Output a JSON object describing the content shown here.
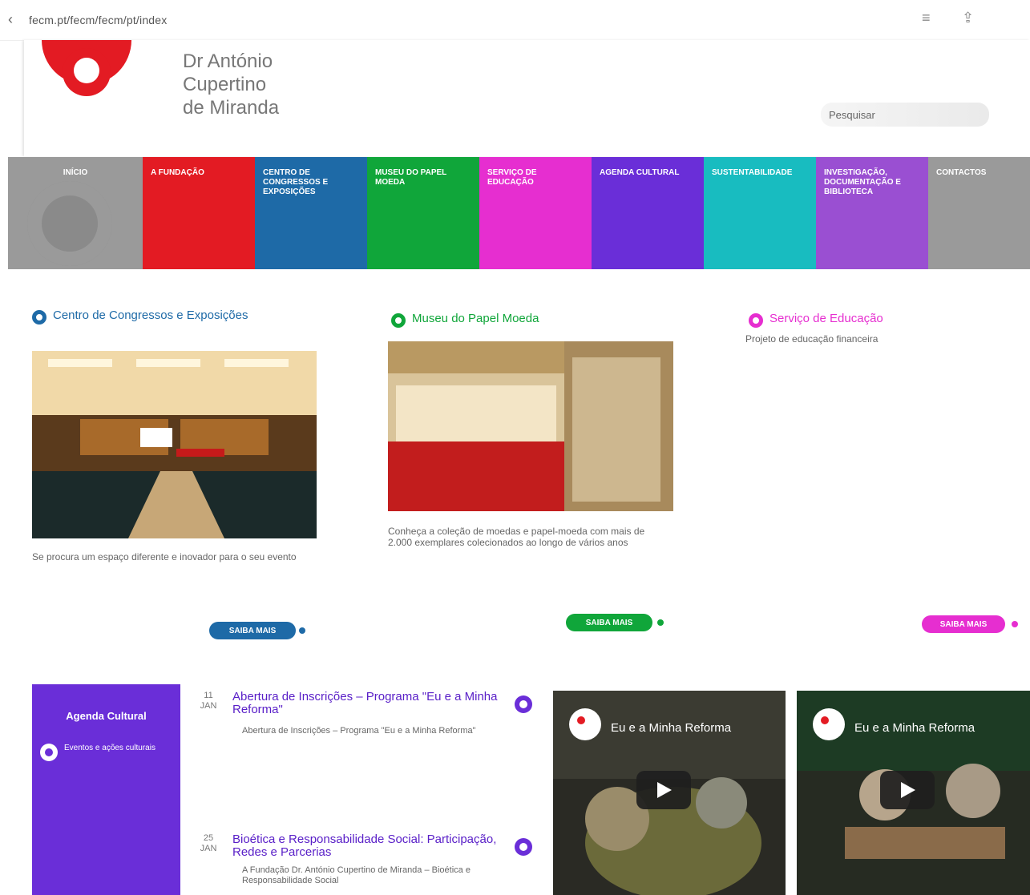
{
  "browser": {
    "url": "fecm.pt/fecm/fecm/pt/index",
    "icons": [
      "menu-icon",
      "share-icon"
    ]
  },
  "header": {
    "brand_lines": [
      "Dr António",
      "Cupertino",
      "de Miranda"
    ],
    "search_placeholder": "Pesquisar",
    "logo_color": "#e31b23"
  },
  "nav": {
    "items": [
      {
        "label": "INÍCIO",
        "color": "#9a9a9a"
      },
      {
        "label": "A FUNDAÇÃO",
        "color": "#e31b23"
      },
      {
        "label": "CENTRO DE CONGRESSOS E EXPOSIÇÕES",
        "color": "#1e6aa7"
      },
      {
        "label": "MUSEU DO PAPEL MOEDA",
        "color": "#10a63a"
      },
      {
        "label": "SERVIÇO DE EDUCAÇÃO",
        "color": "#e62ed0"
      },
      {
        "label": "AGENDA CULTURAL",
        "color": "#6a2ed8"
      },
      {
        "label": "SUSTENTABILIDADE",
        "color": "#18bcc0"
      },
      {
        "label": "INVESTIGAÇÃO, DOCUMENTAÇÃO E BIBLIOTECA",
        "color": "#9a4fd2"
      },
      {
        "label": "CONTACTOS",
        "color": "#9a9a9a"
      }
    ]
  },
  "columns": [
    {
      "title": "Centro de Congressos e Exposições",
      "desc": "Se procura um espaço diferente e inovador para o seu evento",
      "button": "SAIBA MAIS",
      "color": "#1e6aa7"
    },
    {
      "title": "Museu do Papel Moeda",
      "desc": "Conheça a coleção de moedas e papel-moeda com mais de 2.000 exemplares colecionados ao longo de vários anos",
      "button": "SAIBA MAIS",
      "color": "#10a63a"
    },
    {
      "title": "Serviço de Educação",
      "desc": "Projeto de educação financeira",
      "button": "SAIBA MAIS",
      "color": "#e62ed0"
    }
  ],
  "agenda": {
    "title": "Agenda Cultural",
    "link": "Eventos e ações culturais",
    "color": "#6a2ed8",
    "events": [
      {
        "day": "11",
        "month": "JAN",
        "title": "Abertura de Inscrições – Programa \"Eu e a Minha Reforma\"",
        "sub": "Abertura de Inscrições – Programa \"Eu e a Minha Reforma\""
      },
      {
        "day": "25",
        "month": "JAN",
        "title": "Bioética e Responsabilidade Social: Participação, Redes e Parcerias",
        "sub": "A Fundação Dr. António Cupertino de Miranda – Bioética e Responsabilidade Social"
      }
    ]
  },
  "videos": [
    {
      "title": "Eu e a Minha Reforma"
    },
    {
      "title": "Eu e a Minha Reforma"
    }
  ]
}
